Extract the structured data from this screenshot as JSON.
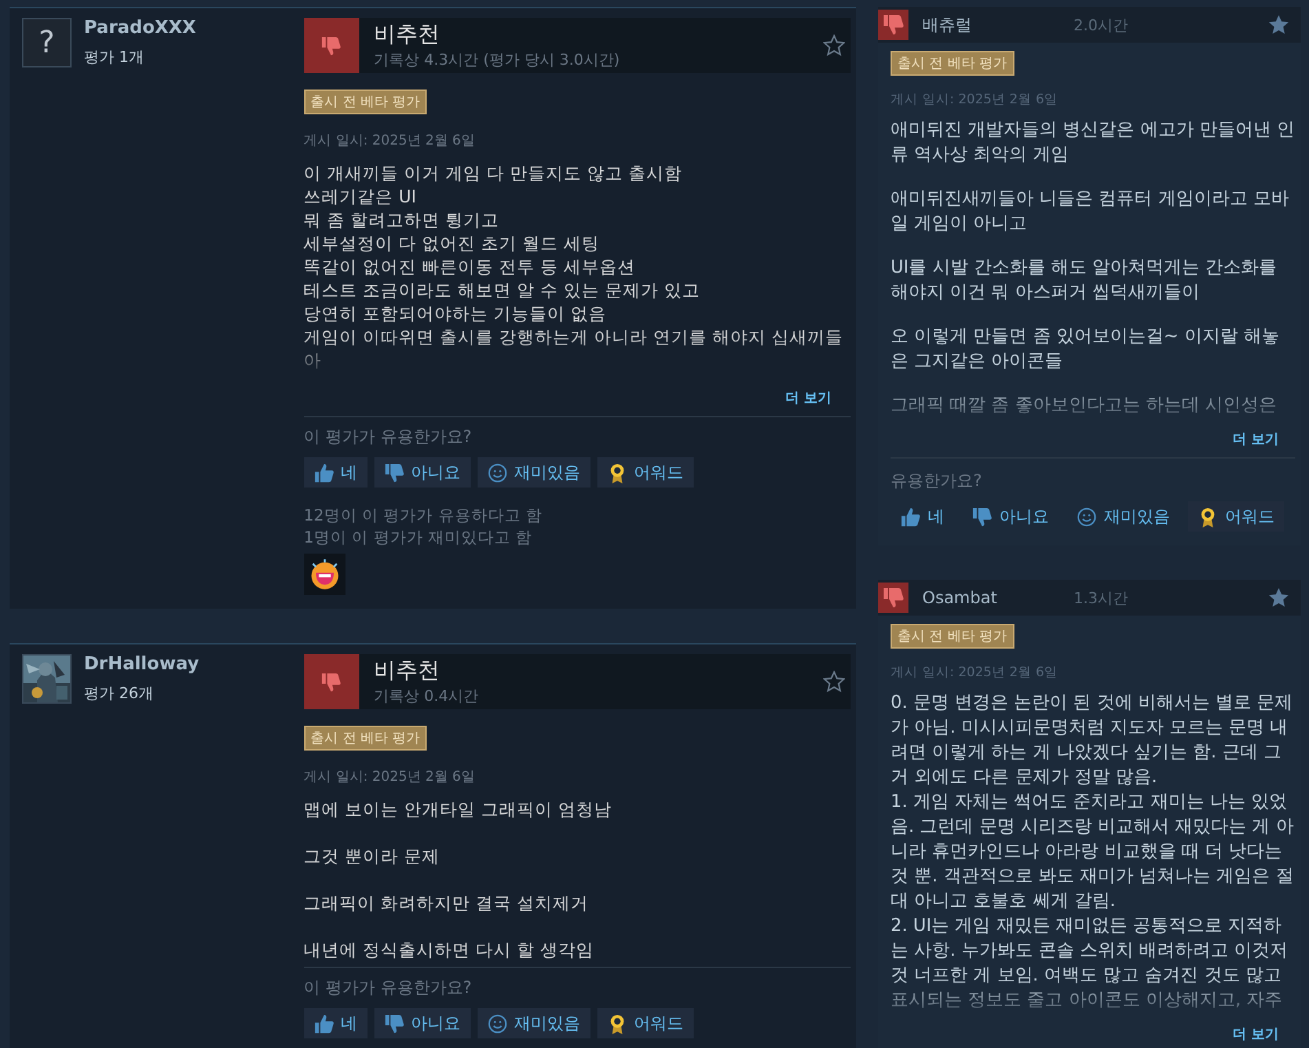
{
  "reviews": [
    {
      "author": "ParadoXXX",
      "avatar": {
        "kind": "placeholder",
        "glyph": "?"
      },
      "review_count": "평가 1개",
      "recommended": false,
      "verdict": "비추천",
      "hours": "기록상 4.3시간 (평가 당시 3.0시간)",
      "badge": "출시 전 베타 평가",
      "date": "게시 일시: 2025년 2월 6일",
      "body": [
        [
          "이 개새끼들 이거 게임 다 만들지도 않고 출시함",
          "쓰레기같은 UI",
          "뭐 좀 할려고하면 튕기고",
          "세부설정이 다 없어진 초기 월드 세팅",
          "똑같이 없어진 빠른이동 전투 등 세부옵션",
          "테스트 조금이라도 해보면 알 수 있는 문제가 있고",
          "당연히 포함되어야하는 기능들이 없음",
          "게임이 이따위면 출시를 강행하는게 아니라 연기를 해야지 십새끼들아"
        ]
      ],
      "truncated": true,
      "more": "더 보기",
      "question": "이 평가가 유용한가요?",
      "buttons": [
        {
          "kind": "yes",
          "label": "네"
        },
        {
          "kind": "no",
          "label": "아니요"
        },
        {
          "kind": "funny",
          "label": "재미있음"
        },
        {
          "kind": "award",
          "label": "어워드"
        }
      ],
      "tallies": [
        "12명이 이 평가가 유용하다고 함",
        "1명이 이 평가가 재미있다고 함"
      ],
      "awards": [
        {
          "kind": "laughing"
        }
      ]
    },
    {
      "author": "DrHalloway",
      "avatar": {
        "kind": "picture"
      },
      "review_count": "평가 26개",
      "recommended": false,
      "verdict": "비추천",
      "hours": "기록상 0.4시간",
      "badge": "출시 전 베타 평가",
      "date": "게시 일시: 2025년 2월 6일",
      "body": [
        [
          "맵에 보이는 안개타일 그래픽이 엄청남"
        ],
        [
          "그것 뿐이라 문제"
        ],
        [
          "그래픽이 화려하지만 결국 설치제거"
        ],
        [
          "내년에 정식출시하면 다시 할 생각임"
        ]
      ],
      "truncated": false,
      "question": "이 평가가 유용한가요?",
      "buttons": [
        {
          "kind": "yes",
          "label": "네"
        },
        {
          "kind": "no",
          "label": "아니요"
        },
        {
          "kind": "funny",
          "label": "재미있음"
        },
        {
          "kind": "award",
          "label": "어워드"
        }
      ]
    }
  ],
  "side_reviews": [
    {
      "author": "배츄럴",
      "recommended": false,
      "hours": "2.0시간",
      "badge": "출시 전 베타 평가",
      "date": "게시 일시: 2025년 2월 6일",
      "body": [
        [
          "애미뒤진 개발자들의 병신같은 에고가 만들어낸 인류 역사상 최악의 게임"
        ],
        [
          "애미뒤진새끼들아 니들은 컴퓨터 게임이라고 모바일 게임이 아니고"
        ],
        [
          "UI를 시발 간소화를 해도 알아쳐먹게는 간소화를 해야지 이건 뭐 아스퍼거 씹덕새끼들이"
        ],
        [
          "오 이렇게 만들면 좀 있어보이는걸~ 이지랄 해놓은 그지같은 아이콘들"
        ],
        [
          "그래픽 때깔 좀 좋아보인다고는 하는데 시인성은"
        ]
      ],
      "truncated": true,
      "more": "더 보기",
      "question": "유용한가요?",
      "buttons": [
        {
          "kind": "yes",
          "label": "네"
        },
        {
          "kind": "no",
          "label": "아니요"
        },
        {
          "kind": "funny",
          "label": "재미있음"
        },
        {
          "kind": "award",
          "label": "어워드"
        }
      ]
    },
    {
      "author": "Osambat",
      "recommended": false,
      "hours": "1.3시간",
      "badge": "출시 전 베타 평가",
      "date": "게시 일시: 2025년 2월 6일",
      "body": [
        [
          "0. 문명 변경은 논란이 된 것에 비해서는 별로 문제가 아님. 미시시피문명처럼 지도자 모르는 문명 내려면 이렇게 하는 게 나았겠다 싶기는 함. 근데 그거 외에도 다른 문제가 정말 많음.",
          "1. 게임 자체는 썩어도 준치라고 재미는 나는 있었음. 그런데 문명 시리즈랑 비교해서 재밌다는 게 아니라 휴먼카인드나 아라랑 비교했을 때 더 낫다는 것 뿐. 객관적으로 봐도 재미가 넘쳐나는 게임은 절대 아니고 호불호 쎄게 갈림.",
          "2. UI는 게임 재밌든 재미없든 공통적으로 지적하는 사항. 누가봐도 콘솔 스위치 배려하려고 이것저것 너프한 게 보임. 여백도 많고 숨겨진 것도 많고 표시되는 정보도 줄고 아이콘도 이상해지고, 자주"
        ]
      ],
      "truncated": true,
      "more": "더 보기"
    }
  ]
}
